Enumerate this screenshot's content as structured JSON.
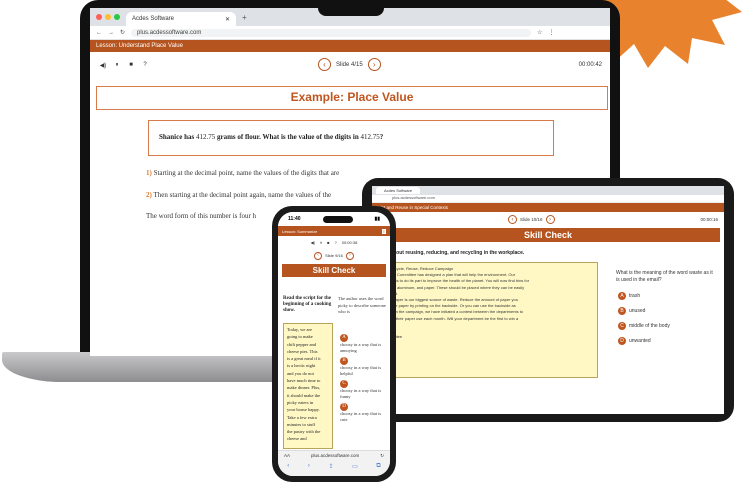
{
  "colors": {
    "accent": "#b5541f",
    "burst": "#e8822c",
    "title_text": "#c0561f",
    "passage_bg": "#fff8c4"
  },
  "laptop": {
    "tab_title": "Acdes Software",
    "url": "plus.acdessoftware.com",
    "lesson_title": "Lesson: Understand Place Value",
    "toolbar_icons": [
      "◀)",
      "⏸",
      "■",
      "?"
    ],
    "slide_prev": "‹",
    "slide_label": "Slide 4/15",
    "slide_next": "›",
    "timer": "00:00:42",
    "heading": "Example: Place Value",
    "question_prefix": "Shanice has",
    "question_num1": "412.75",
    "question_mid": "grams of flour. What is the value of the digits in",
    "question_num2": "412.75",
    "question_end": "?",
    "step1": "Starting at the decimal point, name the values of the digits that are",
    "step2": "Then starting at the decimal point again, name the values of the",
    "word_form": "The word form of this number is four h"
  },
  "tablet": {
    "tab_title": "Acdes Software",
    "lesson_title": "Print and Reuse in Special Contexts",
    "slide_label": "Slide 10/16",
    "timer": "00:00:16",
    "heading": "Skill Check",
    "prompt": "e email about reusing, reducing, and recycling in the workplace.",
    "passage": [
      "Project: Recycle, Reuse, Reduce Campaign",
      "e Go Green Committee has designed a plan that will help the environment. Our",
      "mpany wants to do its part to improve the health of the planet. You will now find bins for",
      "ing plastics, aluminum, and paper. These should be placed where they can be easily",
      "ed and used.",
      "know that paper is our biggest source of waste. Reduce the amount of paper you",
      "beas. Reuse paper by printing on the backside. Or you can use the backside as",
      "per. To begin the campaign, we have initiated a contest between the departments to",
      "can reduce their paper use each month. Will your department be the first to win a",
      "nch?",
      "ares,",
      "een Committee"
    ],
    "question": "What is the meaning of the word waste as it is used in the email?",
    "options": [
      {
        "n": "A",
        "t": "trash"
      },
      {
        "n": "B",
        "t": "unused"
      },
      {
        "n": "C",
        "t": "middle of the body"
      },
      {
        "n": "D",
        "t": "unwanted"
      }
    ]
  },
  "phone": {
    "clock": "11:40",
    "lesson_title": "Lesson: Summarize",
    "timer": "00:00:38",
    "slide_label": "Slide 9/16",
    "heading": "Skill Check",
    "instruction": "Read the script for the beginning of a cooking show.",
    "passage": [
      "Today, we are",
      "going to make",
      "chili pepper and",
      "cheese pies. This",
      "is a great meal if it",
      "is a hectic night",
      "and you do not",
      "have much time to",
      "make dinner. Plus,",
      "it should make the",
      "picky eaters in",
      "your house happy.",
      "Take a few extra",
      "minutes to stuff",
      "the pastry with the",
      "cheese and"
    ],
    "question": "The author uses the word picky to describe someone who is",
    "options": [
      {
        "n": "A",
        "t": "choosy in a way that is annoying"
      },
      {
        "n": "B",
        "t": "choosy in a way that is helpful"
      },
      {
        "n": "C",
        "t": "choosy in a way that is funny"
      },
      {
        "n": "D",
        "t": "choosy in a way that is cute"
      }
    ],
    "url_aa": "AA",
    "url": "plus.acdessoftware.com"
  }
}
